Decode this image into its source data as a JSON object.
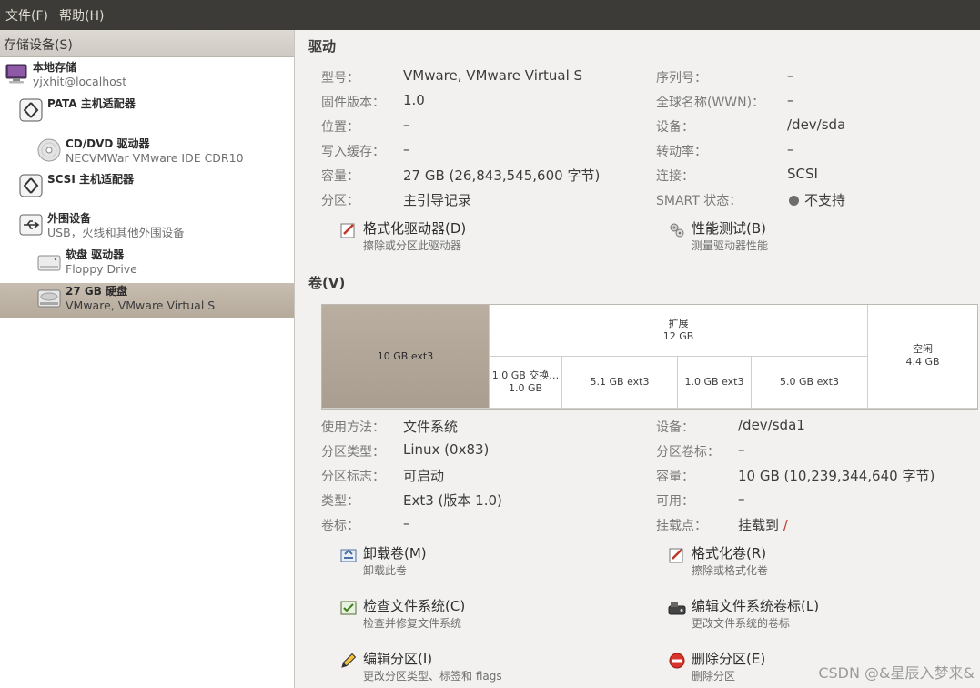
{
  "menubar": {
    "file": "文件(F)",
    "help": "帮助(H)"
  },
  "sidebar": {
    "header": "存储设备(S)",
    "items": [
      {
        "title": "本地存储",
        "sub": "yjxhit@localhost"
      },
      {
        "title": "PATA 主机适配器",
        "sub": ""
      },
      {
        "title": "CD/DVD 驱动器",
        "sub": "NECVMWar VMware IDE CDR10"
      },
      {
        "title": "SCSI 主机适配器",
        "sub": ""
      },
      {
        "title": "外围设备",
        "sub": "USB，火线和其他外围设备"
      },
      {
        "title": "软盘 驱动器",
        "sub": "Floppy Drive"
      },
      {
        "title": "27 GB 硬盘",
        "sub": "VMware, VMware Virtual S"
      }
    ]
  },
  "drive": {
    "title": "驱动",
    "left": [
      {
        "label": "型号：",
        "value": "VMware, VMware Virtual S"
      },
      {
        "label": "固件版本：",
        "value": "1.0"
      },
      {
        "label": "位置：",
        "value": "–"
      },
      {
        "label": "写入缓存：",
        "value": "–"
      },
      {
        "label": "容量：",
        "value": "27 GB (26,843,545,600 字节)"
      },
      {
        "label": "分区：",
        "value": "主引导记录"
      }
    ],
    "right": [
      {
        "label": "序列号：",
        "value": "–"
      },
      {
        "label": "全球名称(WWN)：",
        "value": "–"
      },
      {
        "label": "设备：",
        "value": "/dev/sda"
      },
      {
        "label": "转动率：",
        "value": "–"
      },
      {
        "label": "连接：",
        "value": "SCSI"
      },
      {
        "label": "SMART 状态：",
        "value": "不支持"
      }
    ],
    "actions": [
      {
        "title": "格式化驱动器(D)",
        "desc": "擦除或分区此驱动器"
      },
      {
        "title": "性能测试(B)",
        "desc": "测量驱动器性能"
      }
    ]
  },
  "volumes": {
    "title": "卷(V)",
    "segments": {
      "ext3_10": "10 GB ext3",
      "extended_name": "扩展",
      "extended_size": "12 GB",
      "swap_name": "1.0 GB 交换…",
      "swap_size": "1.0 GB",
      "ext3_51": "5.1 GB ext3",
      "ext3_1": "1.0 GB ext3",
      "ext3_50": "5.0 GB ext3",
      "free_name": "空闲",
      "free_size": "4.4 GB"
    },
    "left": [
      {
        "label": "使用方法：",
        "value": "文件系统"
      },
      {
        "label": "分区类型：",
        "value": "Linux (0x83)"
      },
      {
        "label": "分区标志：",
        "value": "可启动"
      },
      {
        "label": "类型：",
        "value": "Ext3 (版本 1.0)"
      },
      {
        "label": "卷标：",
        "value": "–"
      }
    ],
    "right": [
      {
        "label": "设备：",
        "value": "/dev/sda1"
      },
      {
        "label": "分区卷标：",
        "value": "–"
      },
      {
        "label": "容量：",
        "value": "10 GB (10,239,344,640 字节)"
      },
      {
        "label": "可用：",
        "value": "–"
      },
      {
        "label": "挂载点：",
        "value": "挂载到",
        "link": "/"
      }
    ],
    "actions": [
      {
        "title": "卸载卷(M)",
        "desc": "卸载此卷"
      },
      {
        "title": "格式化卷(R)",
        "desc": "擦除或格式化卷"
      },
      {
        "title": "检查文件系统(C)",
        "desc": "检查并修复文件系统"
      },
      {
        "title": "编辑文件系统卷标(L)",
        "desc": "更改文件系统的卷标"
      },
      {
        "title": "编辑分区(I)",
        "desc": "更改分区类型、标签和 flags"
      },
      {
        "title": "删除分区(E)",
        "desc": "删除分区"
      }
    ]
  },
  "watermark": "CSDN @&星辰入梦来&"
}
